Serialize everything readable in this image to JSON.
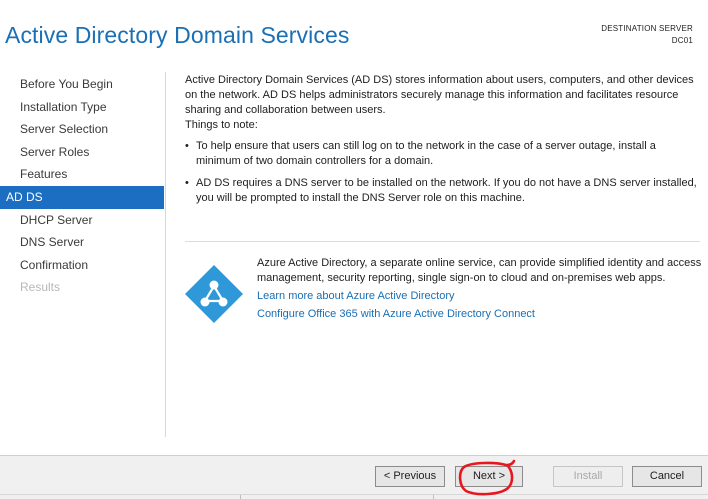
{
  "header": {
    "title": "Active Directory Domain Services",
    "destination_label": "DESTINATION SERVER",
    "destination_server": "DC01"
  },
  "nav": {
    "items": [
      {
        "label": "Before You Begin",
        "state": "normal"
      },
      {
        "label": "Installation Type",
        "state": "normal"
      },
      {
        "label": "Server Selection",
        "state": "normal"
      },
      {
        "label": "Server Roles",
        "state": "normal"
      },
      {
        "label": "Features",
        "state": "normal"
      },
      {
        "label": "AD DS",
        "state": "active"
      },
      {
        "label": "DHCP Server",
        "state": "normal"
      },
      {
        "label": "DNS Server",
        "state": "normal"
      },
      {
        "label": "Confirmation",
        "state": "normal"
      },
      {
        "label": "Results",
        "state": "disabled"
      }
    ]
  },
  "content": {
    "intro": "Active Directory Domain Services (AD DS) stores information about users, computers, and other devices on the network.  AD DS helps administrators securely manage this information and facilitates resource sharing and collaboration between users.",
    "things_heading": "Things to note:",
    "bullets": [
      "To help ensure that users can still log on to the network in the case of a server outage, install a minimum of two domain controllers for a domain.",
      "AD DS requires a DNS server to be installed on the network.  If you do not have a DNS server installed, you will be prompted to install the DNS Server role on this machine."
    ]
  },
  "azure": {
    "icon": "azure-ad-icon",
    "description": "Azure Active Directory, a separate online service, can provide simplified identity and access management, security reporting, single sign-on to cloud and on-premises web apps.",
    "link_learn": "Learn more about Azure Active Directory",
    "link_configure": "Configure Office 365 with Azure Active Directory Connect"
  },
  "footer": {
    "previous_label": "< Previous",
    "next_label": "Next >",
    "install_label": "Install",
    "cancel_label": "Cancel"
  },
  "colors": {
    "accent": "#1a6fb5",
    "nav_active_bg": "#1b6ec2",
    "annotation": "#e8171f"
  }
}
